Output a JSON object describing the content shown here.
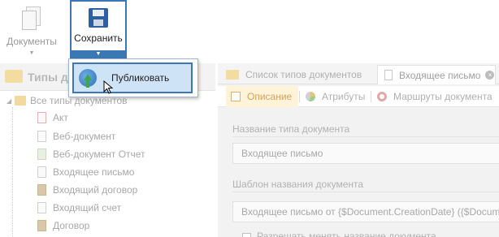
{
  "toolbar": {
    "documents_label": "Документы",
    "save_label": "Сохранить"
  },
  "dropdown": {
    "publish_label": "Публиковать"
  },
  "tree": {
    "header_title": "Типы до",
    "root_label": "Все типы документов",
    "items": [
      {
        "label": "Акт",
        "icon": "document-icon"
      },
      {
        "label": "Веб-документ",
        "icon": "document-icon"
      },
      {
        "label": "Веб-документ Отчет",
        "icon": "document-icon"
      },
      {
        "label": "Входящее письмо",
        "icon": "document-icon"
      },
      {
        "label": "Входящий договор",
        "icon": "contract-icon"
      },
      {
        "label": "Входящий счет",
        "icon": "document-icon"
      },
      {
        "label": "Договор",
        "icon": "contract-icon"
      }
    ]
  },
  "tabs": [
    {
      "label": "Список типов документов",
      "icon": "folder-icon"
    },
    {
      "label": "Входящее письмо",
      "icon": "document-icon"
    }
  ],
  "subtabs": [
    {
      "label": "Описание",
      "icon": "info-icon",
      "selected": true
    },
    {
      "label": "Атрибуты",
      "icon": "pie-icon"
    },
    {
      "label": "Маршруты документа",
      "icon": "ring-icon"
    }
  ],
  "form": {
    "doc_type_name_label": "Название типа документа",
    "doc_type_name_value": "Входящее письмо",
    "template_label": "Шаблон названия документа",
    "template_value": "Входящее письмо от {$Document.CreationDate} ({$Documen",
    "allow_change_label": "Разрешать менять название документа"
  },
  "colors": {
    "accent": "#3a78b5",
    "highlight": "#cfe3f7",
    "selected_tab": "#fff3da"
  }
}
